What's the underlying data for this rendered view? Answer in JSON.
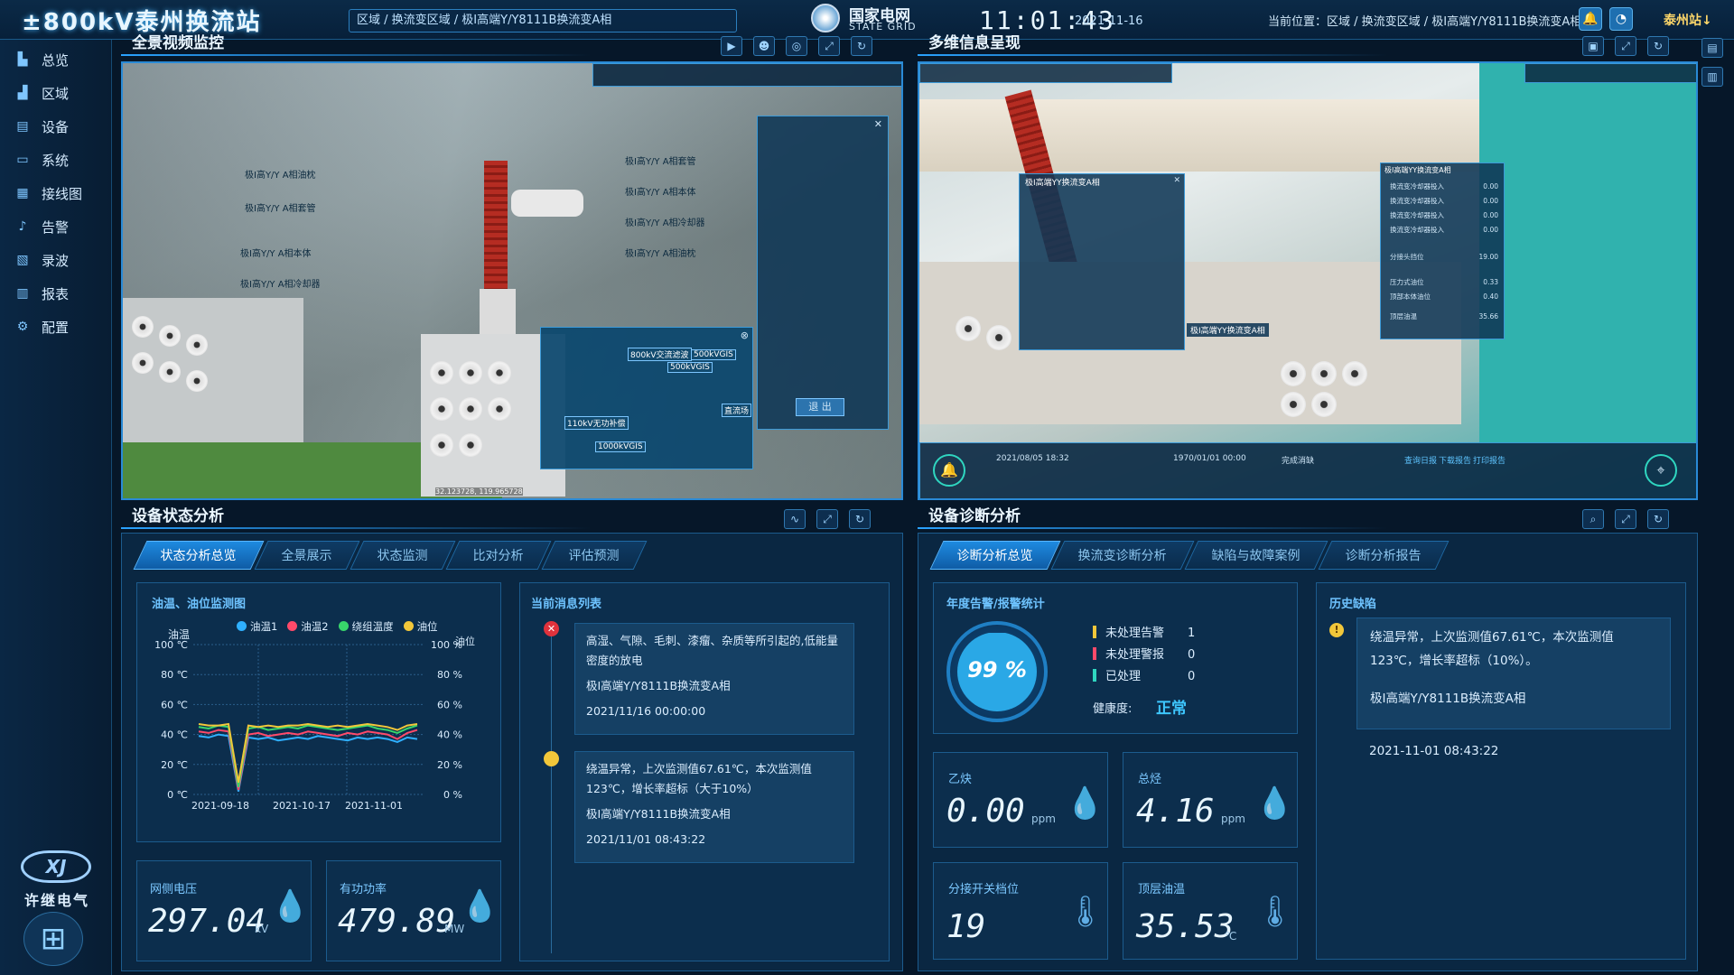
{
  "header": {
    "station_title": "±800kV泰州换流站",
    "path": "区域 / 换流变区域 / 极Ⅰ高端Y/Y8111B换流变A相",
    "logo_cn": "国家电网",
    "logo_en": "STATE GRID",
    "time": "11:01:43",
    "date": "2021-11-16",
    "location": "当前位置：区域 / 换流变区域 / 极Ⅰ高端Y/Y8111B换流变A相",
    "station_link": "泰州站↓",
    "icons": [
      "bell-icon",
      "gauge-icon"
    ]
  },
  "sidebar": {
    "items": [
      {
        "label": "总览",
        "icon": "building-icon"
      },
      {
        "label": "区域",
        "icon": "area-icon"
      },
      {
        "label": "设备",
        "icon": "device-icon"
      },
      {
        "label": "系统",
        "icon": "monitor-icon"
      },
      {
        "label": "接线图",
        "icon": "wiring-icon"
      },
      {
        "label": "告警",
        "icon": "alarm-bell-icon"
      },
      {
        "label": "录波",
        "icon": "waveform-icon"
      },
      {
        "label": "报表",
        "icon": "report-icon"
      },
      {
        "label": "配置",
        "icon": "config-gear-icon"
      }
    ],
    "brand_mark": "XJ",
    "brand_name": "许继电气"
  },
  "video_panel": {
    "title": "全景视频监控",
    "callouts": [
      "极Ⅰ高Y/Y A相油枕",
      "极Ⅰ高Y/Y A相套管",
      "极Ⅰ高Y/Y A相本体",
      "极Ⅰ高Y/Y A相冷却器"
    ],
    "right_callouts": [
      "极Ⅰ高Y/Y A相套管",
      "极Ⅰ高Y/Y A相本体",
      "极Ⅰ高Y/Y A相冷却器",
      "极Ⅰ高Y/Y A相油枕"
    ],
    "map_labels": [
      "800kV交流滤波",
      "500kVGIS",
      "500kVGIS",
      "110kV无功补偿",
      "1000kVGIS",
      "直流场"
    ],
    "exit_button": "退 出",
    "coords": "32.123728, 119.965728"
  },
  "multi_panel": {
    "title": "多维信息呈现",
    "info_title": "极Ⅰ高端YY换流变A相",
    "bottom_date1": "2021/08/05 18:32",
    "bottom_date2": "1970/01/01 00:00",
    "bottom_status": "完成消缺",
    "bottom_links": [
      "查询日报",
      "下载报告",
      "打印报告"
    ],
    "side_title": "极Ⅰ高端YY换流变A相",
    "side_rows": [
      {
        "label": "换流变冷却器投入",
        "value": "0.00"
      },
      {
        "label": "换流变冷却器投入",
        "value": "0.00"
      },
      {
        "label": "换流变冷却器投入",
        "value": "0.00"
      },
      {
        "label": "换流变冷却器投入",
        "value": "0.00"
      },
      {
        "label": "分接头挡位",
        "value": "19.00"
      },
      {
        "label": "压力式油位",
        "value": "0.33"
      },
      {
        "label": "顶部本体油位",
        "value": "0.40"
      },
      {
        "label": "顶层油温",
        "value": "35.66"
      }
    ]
  },
  "status_panel": {
    "title": "设备状态分析",
    "tabs": [
      "状态分析总览",
      "全景展示",
      "状态监测",
      "比对分析",
      "评估预测"
    ],
    "chart_title": "油温、油位监测图",
    "left_axis_title": "油温",
    "right_axis_title": "油位",
    "metrics": [
      {
        "label": "网侧电压",
        "value": "297.04",
        "unit": "kV"
      },
      {
        "label": "有功功率",
        "value": "479.89",
        "unit": "MW"
      }
    ],
    "messages_title": "当前消息列表",
    "messages": [
      {
        "text": "高湿、气隙、毛刺、漆瘤、杂质等所引起的,低能量密度的放电",
        "device": "极Ⅰ高端Y/Y8111B换流变A相",
        "time": "2021/11/16 00:00:00",
        "status_color": "#e0323c"
      },
      {
        "text": "绕温异常，上次监测值67.61℃，本次监测值123℃，增长率超标（大于10%）",
        "device": "极Ⅰ高端Y/Y8111B换流变A相",
        "time": "2021/11/01 08:43:22",
        "status_color": "#f2c73a"
      }
    ]
  },
  "chart_data": {
    "type": "line",
    "title": "油温、油位监测图",
    "x": [
      "2021-09-18",
      "2021-10-17",
      "2021-11-01"
    ],
    "y_left_ticks": [
      "100 ℃",
      "80 ℃",
      "60 ℃",
      "40 ℃",
      "20 ℃",
      "0 ℃"
    ],
    "y_right_ticks": [
      "100 %",
      "80 %",
      "60 %",
      "40 %",
      "20 %",
      "0 %"
    ],
    "ylim": [
      0,
      100
    ],
    "series": [
      {
        "name": "油温1",
        "color": "#2fb0ff",
        "values": [
          39,
          38,
          40,
          39,
          2,
          38,
          37,
          38,
          36,
          37,
          38,
          37,
          39,
          38,
          37,
          36,
          38,
          37,
          38,
          37,
          35,
          38,
          37
        ]
      },
      {
        "name": "油温2",
        "color": "#ff4a6a",
        "values": [
          42,
          41,
          43,
          42,
          3,
          40,
          41,
          39,
          40,
          41,
          40,
          42,
          41,
          40,
          39,
          41,
          40,
          42,
          41,
          40,
          37,
          41,
          43
        ]
      },
      {
        "name": "绕组温度",
        "color": "#38d66b",
        "values": [
          45,
          44,
          46,
          45,
          5,
          44,
          45,
          43,
          44,
          45,
          44,
          46,
          45,
          44,
          43,
          44,
          45,
          46,
          44,
          43,
          41,
          44,
          46
        ]
      },
      {
        "name": "油位",
        "color": "#f2c73a",
        "values": [
          47,
          46,
          46,
          47,
          8,
          46,
          45,
          46,
          45,
          46,
          46,
          47,
          46,
          45,
          46,
          45,
          46,
          47,
          46,
          45,
          43,
          46,
          47
        ]
      }
    ]
  },
  "diagnosis_panel": {
    "title": "设备诊断分析",
    "tabs": [
      "诊断分析总览",
      "换流变诊断分析",
      "缺陷与故障案例",
      "诊断分析报告"
    ],
    "alarm_title": "年度告警/报警统计",
    "percent": "99 %",
    "percent_value": 0.99,
    "alarm_stats": [
      {
        "label": "未处理告警",
        "value": "1",
        "color": "#f2c73a"
      },
      {
        "label": "未处理警报",
        "value": "0",
        "color": "#ff4a6a"
      },
      {
        "label": "已处理",
        "value": "0",
        "color": "#2fd6c0"
      }
    ],
    "health_label": "健康度:",
    "health_value": "正常",
    "history_title": "历史缺陷",
    "history_text": "绕温异常，上次监测值67.61℃，本次监测值123℃，增长率超标（10%）。",
    "history_device": "极Ⅰ高端Y/Y8111B换流变A相",
    "history_time": "2021-11-01 08:43:22",
    "metrics": [
      {
        "label": "乙炔",
        "value": "0.00",
        "unit": "ppm"
      },
      {
        "label": "总烃",
        "value": "4.16",
        "unit": "ppm"
      },
      {
        "label": "分接开关档位",
        "value": "19",
        "unit": ""
      },
      {
        "label": "顶层油温",
        "value": "35.53",
        "unit": "℃"
      }
    ]
  }
}
